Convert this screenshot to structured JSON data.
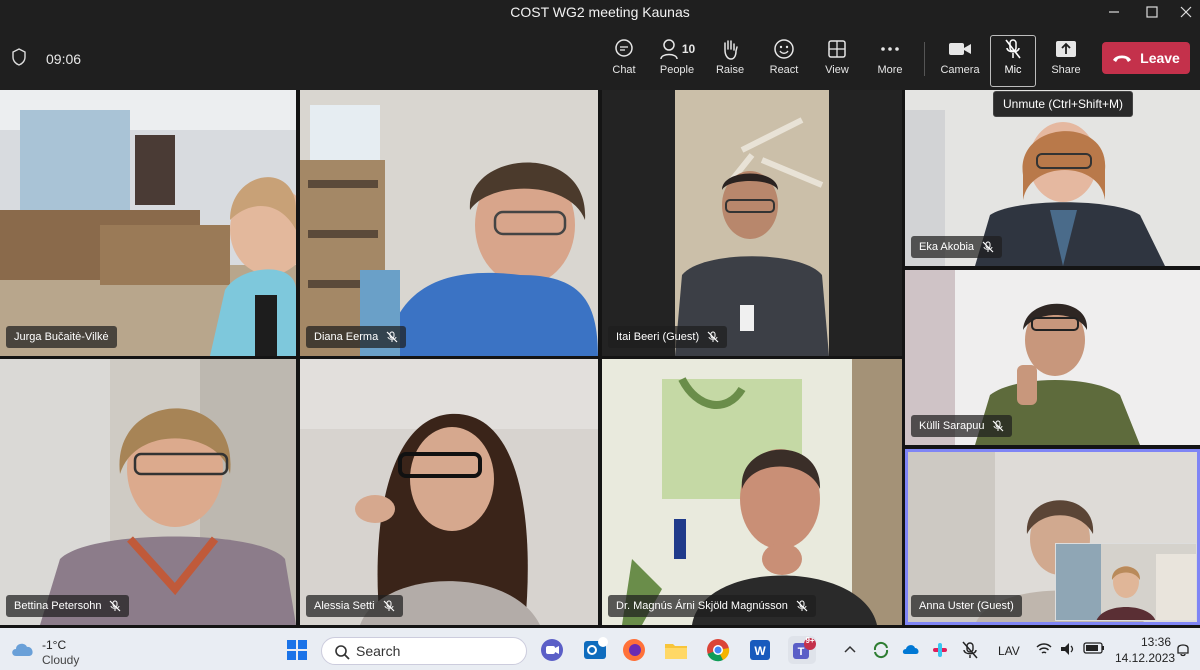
{
  "window": {
    "title": "COST WG2 meeting Kaunas"
  },
  "meeting": {
    "elapsed": "09:06"
  },
  "toolbar": {
    "chat_label": "Chat",
    "people_label": "People",
    "people_count": "10",
    "raise_label": "Raise",
    "react_label": "React",
    "view_label": "View",
    "more_label": "More",
    "camera_label": "Camera",
    "mic_label": "Mic",
    "share_label": "Share",
    "leave_label": "Leave"
  },
  "tooltip": {
    "text": "Unmute (Ctrl+Shift+M)"
  },
  "participants": [
    {
      "name": "Jurga Bučaitė-Vilkė",
      "muted": false
    },
    {
      "name": "Diana Eerma",
      "muted": true
    },
    {
      "name": "Itai Beeri (Guest)",
      "muted": true
    },
    {
      "name": "Eka Akobia",
      "muted": true
    },
    {
      "name": "Külli Sarapuu",
      "muted": true
    },
    {
      "name": "Bettina Petersohn",
      "muted": true
    },
    {
      "name": "Alessia Setti",
      "muted": true
    },
    {
      "name": "Dr. Magnús Árni Skjöld Magnússon",
      "muted": true
    },
    {
      "name": "Anna Uster (Guest)",
      "muted": false
    }
  ],
  "taskbar": {
    "weather_temp": "-1°C",
    "weather_condition": "Cloudy",
    "search_placeholder": "Search",
    "teams_badge": "9+",
    "outlook_badge": "",
    "language": "LAV",
    "time": "13:36",
    "date": "14.12.2023"
  },
  "colors": {
    "leave": "#c4314b",
    "active_speaker": "#7f85f5",
    "toolbar_bg": "#1f1f1f"
  }
}
